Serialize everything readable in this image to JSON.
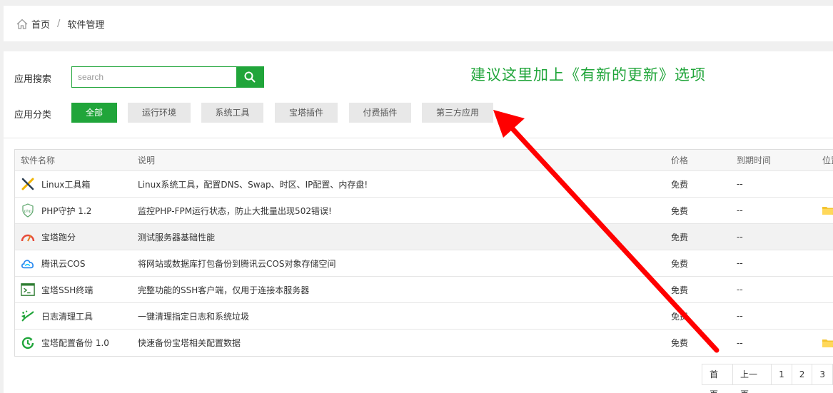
{
  "breadcrumb": {
    "home": "首页",
    "separator": "/",
    "current": "软件管理"
  },
  "search": {
    "label": "应用搜索",
    "placeholder": "search"
  },
  "category": {
    "label": "应用分类",
    "items": [
      "全部",
      "运行环境",
      "系统工具",
      "宝塔插件",
      "付费插件",
      "第三方应用"
    ],
    "active_index": 0
  },
  "annotation": "建议这里加上《有新的更新》选项",
  "table": {
    "headers": {
      "name": "软件名称",
      "desc": "说明",
      "price": "价格",
      "expire": "到期时间",
      "position": "位置"
    },
    "rows": [
      {
        "icon": "tools-icon",
        "name": "Linux工具箱",
        "desc": "Linux系统工具，配置DNS、Swap、时区、IP配置、内存盘!",
        "price": "免费",
        "expire": "--",
        "folder": false
      },
      {
        "icon": "php-shield-icon",
        "name": "PHP守护 1.2",
        "desc": "监控PHP-FPM运行状态，防止大批量出现502错误!",
        "price": "免费",
        "expire": "--",
        "folder": true
      },
      {
        "icon": "speedometer-icon",
        "name": "宝塔跑分",
        "desc": "测试服务器基础性能",
        "price": "免费",
        "expire": "--",
        "folder": false
      },
      {
        "icon": "cloud-icon",
        "name": "腾讯云COS",
        "desc": "将网站或数据库打包备份到腾讯云COS对象存储空间",
        "price": "免费",
        "expire": "--",
        "folder": false
      },
      {
        "icon": "terminal-icon",
        "name": "宝塔SSH终端",
        "desc": "完整功能的SSH客户端，仅用于连接本服务器",
        "price": "免费",
        "expire": "--",
        "folder": false
      },
      {
        "icon": "broom-icon",
        "name": "日志清理工具",
        "desc": "一键清理指定日志和系统垃圾",
        "price": "免费",
        "expire": "--",
        "folder": false
      },
      {
        "icon": "backup-clock-icon",
        "name": "宝塔配置备份 1.0",
        "desc": "快速备份宝塔相关配置数据",
        "price": "免费",
        "expire": "--",
        "folder": true
      }
    ]
  },
  "pagination": [
    "首页",
    "上一页",
    "1",
    "2",
    "3"
  ],
  "colors": {
    "accent": "#20a53a",
    "arrow": "#ff0000"
  }
}
